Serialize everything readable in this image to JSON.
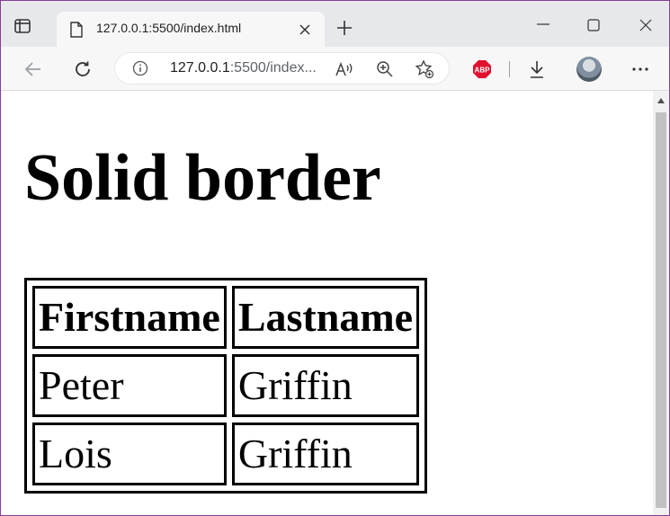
{
  "browser": {
    "tab": {
      "title": "127.0.0.1:5500/index.html"
    },
    "address": {
      "host": "127.0.0.1",
      "path": ":5500/index..."
    },
    "icons": {
      "tab_actions": "tab-actions-icon",
      "page": "page-icon",
      "close": "close-icon",
      "new_tab": "plus-icon",
      "minimize": "minimize-icon",
      "maximize": "maximize-icon",
      "window_close": "close-icon",
      "back": "back-arrow-icon",
      "refresh": "refresh-icon",
      "info": "info-icon",
      "read_aloud": "read-aloud-icon",
      "zoom": "zoom-in-icon",
      "favorites": "add-favorite-icon",
      "adblock": "adblock-plus-icon",
      "downloads": "download-icon",
      "profile": "profile-avatar",
      "menu": "more-icon"
    },
    "adblock_label": "ABP",
    "colors": {
      "tabbar": "#e7e8eb",
      "toolbar": "#f7f7f7",
      "adblock": "#e0102e"
    }
  },
  "page": {
    "heading": "Solid border",
    "table": {
      "headers": [
        "Firstname",
        "Lastname"
      ],
      "rows": [
        [
          "Peter",
          "Griffin"
        ],
        [
          "Lois",
          "Griffin"
        ]
      ]
    }
  }
}
